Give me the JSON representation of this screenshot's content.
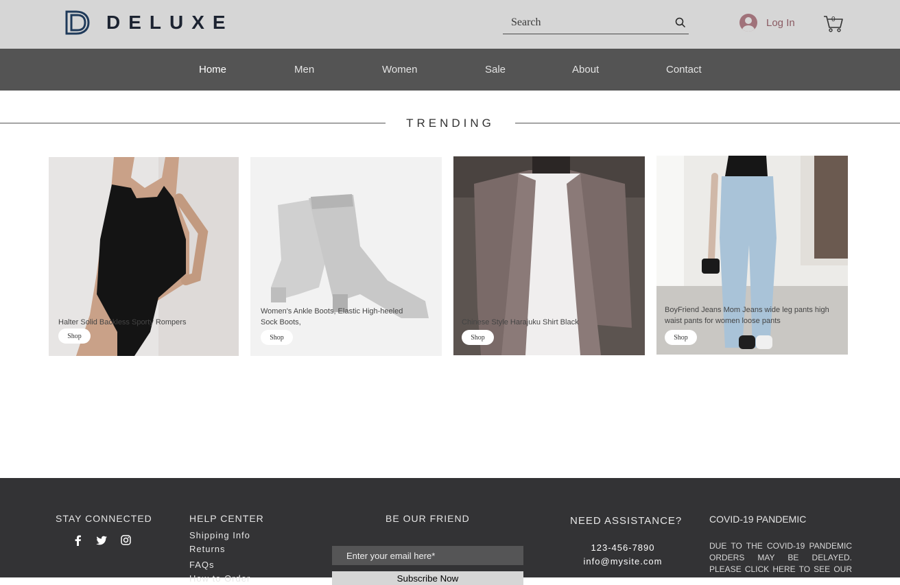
{
  "header": {
    "brand": "DELUXE",
    "search_placeholder": "Search",
    "login_label": "Log In",
    "cart_count": "0"
  },
  "nav": {
    "items": [
      {
        "label": "Home",
        "active": true
      },
      {
        "label": "Men"
      },
      {
        "label": "Women"
      },
      {
        "label": "Sale"
      },
      {
        "label": "About"
      },
      {
        "label": "Contact"
      }
    ]
  },
  "trending": {
    "title": "TRENDING",
    "products": [
      {
        "name": "Halter Solid Backless Sporty Rompers",
        "button": "Shop"
      },
      {
        "name": "Women's Ankle Boots, Elastic High-heeled Sock Boots,",
        "button": "Shop"
      },
      {
        "name": "Chinese Style Harajuku Shirt Black",
        "button": "Shop"
      },
      {
        "name": "BoyFriend Jeans Mom Jeans wide leg pants high waist pants for women loose pants",
        "button": "Shop"
      }
    ]
  },
  "footer": {
    "stay_connected": "STAY CONNECTED",
    "social": [
      "facebook-icon",
      "twitter-icon",
      "instagram-icon"
    ],
    "help_center": "HELP CENTER",
    "help_links": [
      "Shipping Info",
      "Returns",
      "FAQs",
      "How to Order"
    ],
    "be_our_friend": "BE OUR FRIEND",
    "email_placeholder": "Enter your email here*",
    "subscribe_label": "Subscribe Now",
    "need_assistance": "NEED ASSISTANCE?",
    "phone": "123-456-7890",
    "email": "info@mysite.com",
    "covid_title": "COVID-19 PANDEMIC",
    "covid_text": "DUE TO THE COVID-19 PANDEMIC ORDERS MAY BE DELAYED. PLEASE CLICK HERE TO SEE OUR"
  },
  "colors": {
    "header_bg": "#d6d6d6",
    "nav_bg": "#545454",
    "footer_bg": "#333335",
    "login_accent": "#a0727a"
  }
}
